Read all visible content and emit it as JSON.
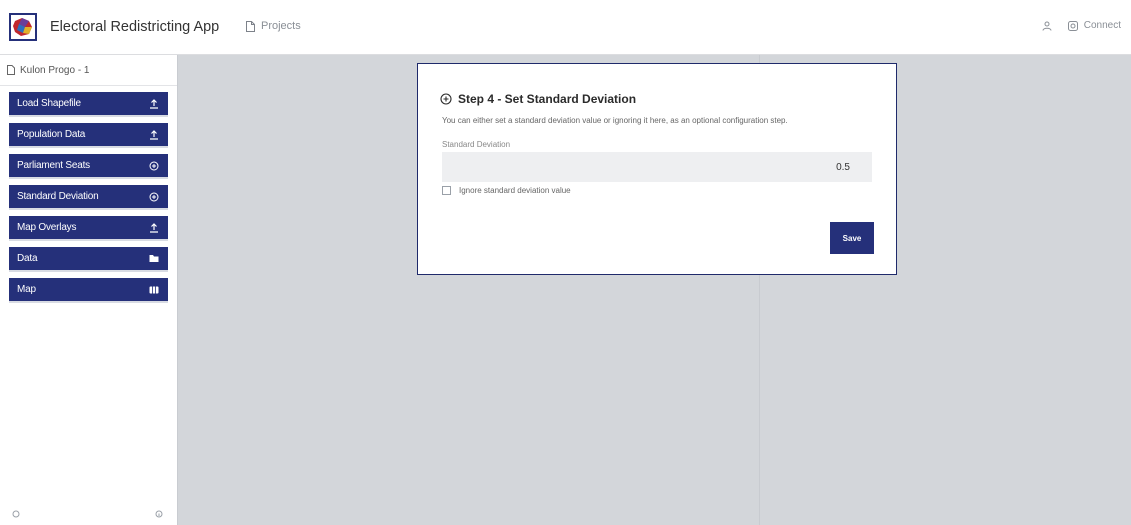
{
  "header": {
    "app_title": "Electoral Redistricting App",
    "projects_label": "Projects",
    "connect_label": "Connect"
  },
  "sidebar": {
    "project_name": "Kulon Progo - 1",
    "steps": [
      {
        "label": "Load Shapefile",
        "icon": "upload-icon"
      },
      {
        "label": "Population Data",
        "icon": "upload-icon"
      },
      {
        "label": "Parliament Seats",
        "icon": "plus-circle-icon"
      },
      {
        "label": "Standard Deviation",
        "icon": "plus-circle-icon"
      },
      {
        "label": "Map Overlays",
        "icon": "upload-icon"
      },
      {
        "label": "Data",
        "icon": "folder-icon"
      },
      {
        "label": "Map",
        "icon": "map-icon"
      }
    ]
  },
  "card": {
    "title": "Step 4 - Set Standard Deviation",
    "description": "You can either set a standard deviation value or ignoring it here, as an optional configuration step.",
    "field_label": "Standard Deviation",
    "field_value": "0.5",
    "checkbox_label": "Ignore standard deviation value",
    "save_label": "Save"
  },
  "colors": {
    "primary": "#25307a",
    "background": "#d3d6da",
    "card_border": "#1f2a6b"
  }
}
